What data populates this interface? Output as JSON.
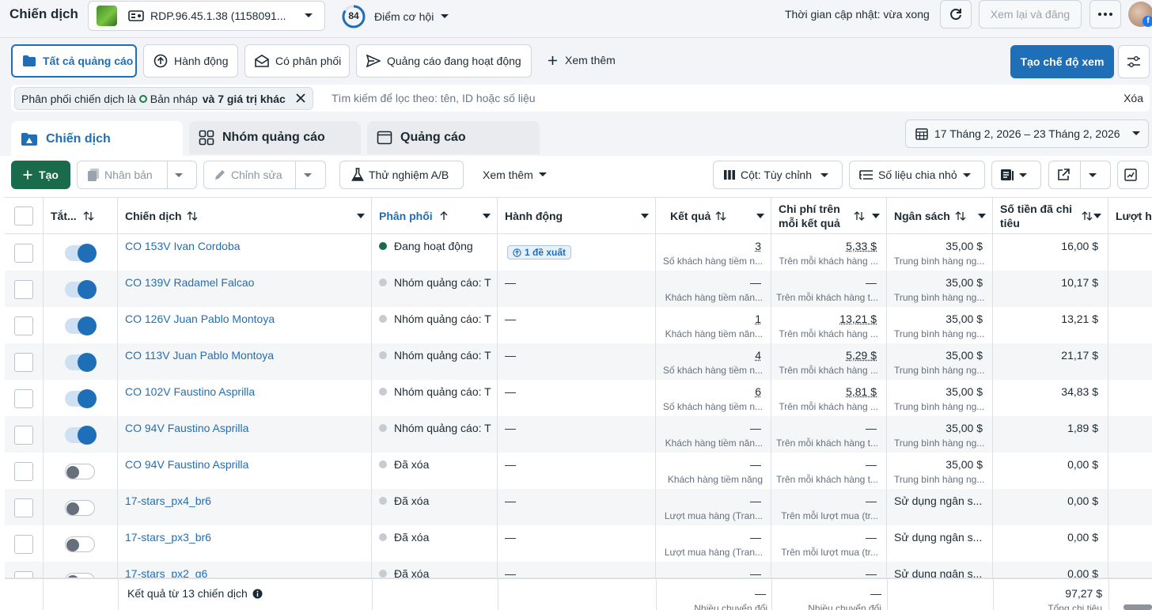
{
  "topbar": {
    "title": "Chiến dịch",
    "account_label": "RDP.96.45.1.38 (1158091...",
    "score": "84",
    "score_label": "Điểm cơ hội",
    "updated": "Thời gian cập nhật: vừa xong",
    "review_label": "Xem lại và đăng"
  },
  "views": {
    "all": "Tất cả quảng cáo",
    "action": "Hành động",
    "delivery": "Có phân phối",
    "active": "Quảng cáo đang hoạt động",
    "more": "Xem thêm",
    "create_view": "Tạo chế độ xem"
  },
  "filter": {
    "chip_prefix": "Phân phối chiến dịch là",
    "chip_value": "Bản nháp",
    "chip_more": "và 7 giá trị khác",
    "search_placeholder": "Tìm kiếm để lọc theo: tên, ID hoặc số liệu",
    "clear": "Xóa"
  },
  "level_tabs": {
    "campaign": "Chiến dịch",
    "adset": "Nhóm quảng cáo",
    "ad": "Quảng cáo"
  },
  "date_range": "17 Tháng 2, 2026 – 23 Tháng 2, 2026",
  "toolbar": {
    "create": "Tạo",
    "duplicate": "Nhân bản",
    "edit": "Chỉnh sửa",
    "ab_test": "Thử nghiệm A/B",
    "more": "Xem thêm",
    "columns": "Cột: Tùy chỉnh",
    "breakdown": "Số liệu chia nhỏ"
  },
  "columns": {
    "onoff": "Tắt...",
    "campaign": "Chiến dịch",
    "delivery": "Phân phối",
    "action": "Hành động",
    "results": "Kết quả",
    "cpr_line1": "Chi phí trên",
    "cpr_line2": "mỗi kết quả",
    "budget": "Ngân sách",
    "spent_line1": "Số tiền đã chi",
    "spent_line2": "tiêu",
    "reach": "Lượt h"
  },
  "rows": [
    {
      "on": true,
      "name": "CO 153V Ivan Cordoba",
      "status": "active",
      "delivery": "Đang hoạt động",
      "action": "1 đề xuất",
      "results": "3",
      "results_sub": "Số khách hàng tiềm n...",
      "cpr": "5,33 $",
      "cpr_sub": "Trên mỗi khách hàng ...",
      "budget": "35,00 $",
      "budget_sub": "Trung bình hàng ng...",
      "spent": "16,00 $"
    },
    {
      "on": true,
      "name": "CO 139V Radamel Falcao",
      "status": "inactive",
      "delivery": "Nhóm quảng cáo: T",
      "action": "—",
      "results": "—",
      "results_sub": "Khách hàng tiềm năn...",
      "cpr": "—",
      "cpr_sub": "Trên mỗi khách hàng t...",
      "budget": "35,00 $",
      "budget_sub": "Trung bình hàng ng...",
      "spent": "10,17 $"
    },
    {
      "on": true,
      "name": "CO 126V Juan Pablo Montoya",
      "status": "inactive",
      "delivery": "Nhóm quảng cáo: T",
      "action": "—",
      "results": "1",
      "results_sub": "Khách hàng tiềm năn...",
      "cpr": "13,21 $",
      "cpr_sub": "Trên mỗi khách hàng ...",
      "budget": "35,00 $",
      "budget_sub": "Trung bình hàng ng...",
      "spent": "13,21 $"
    },
    {
      "on": true,
      "name": "CO 113V Juan Pablo Montoya",
      "status": "inactive",
      "delivery": "Nhóm quảng cáo: T",
      "action": "—",
      "results": "4",
      "results_sub": "Số khách hàng tiềm n...",
      "cpr": "5,29 $",
      "cpr_sub": "Trên mỗi khách hàng ...",
      "budget": "35,00 $",
      "budget_sub": "Trung bình hàng ng...",
      "spent": "21,17 $"
    },
    {
      "on": true,
      "name": "CO 102V Faustino Asprilla",
      "status": "inactive",
      "delivery": "Nhóm quảng cáo: T",
      "action": "—",
      "results": "6",
      "results_sub": "Số khách hàng tiềm n...",
      "cpr": "5,81 $",
      "cpr_sub": "Trên mỗi khách hàng ...",
      "budget": "35,00 $",
      "budget_sub": "Trung bình hàng ng...",
      "spent": "34,83 $"
    },
    {
      "on": true,
      "name": "CO 94V Faustino Asprilla",
      "status": "inactive",
      "delivery": "Nhóm quảng cáo: T",
      "action": "—",
      "results": "—",
      "results_sub": "Khách hàng tiềm năn...",
      "cpr": "—",
      "cpr_sub": "Trên mỗi khách hàng t...",
      "budget": "35,00 $",
      "budget_sub": "Trung bình hàng ng...",
      "spent": "1,89 $"
    },
    {
      "on": false,
      "name": "CO 94V Faustino Asprilla",
      "status": "deleted",
      "delivery": "Đã xóa",
      "action": "—",
      "results": "—",
      "results_sub": "Khách hàng tiềm năng",
      "cpr": "—",
      "cpr_sub": "Trên mỗi khách hàng t...",
      "budget": "35,00 $",
      "budget_sub": "Trung bình hàng ng...",
      "spent": "0,00 $"
    },
    {
      "on": false,
      "name": "17-stars_px4_br6",
      "status": "deleted",
      "delivery": "Đã xóa",
      "action": "—",
      "results": "—",
      "results_sub": "Lượt mua hàng (Tran...",
      "cpr": "—",
      "cpr_sub": "Trên mỗi lượt mua (tr...",
      "budget": "Sử dụng ngân s...",
      "budget_sub": "",
      "spent": "0,00 $"
    },
    {
      "on": false,
      "name": "17-stars_px3_br6",
      "status": "deleted",
      "delivery": "Đã xóa",
      "action": "—",
      "results": "—",
      "results_sub": "Lượt mua hàng (Tran...",
      "cpr": "—",
      "cpr_sub": "Trên mỗi lượt mua (tr...",
      "budget": "Sử dụng ngân s...",
      "budget_sub": "",
      "spent": "0,00 $"
    },
    {
      "on": false,
      "name": "17-stars_px2_g6",
      "status": "deleted",
      "delivery": "Đã xóa",
      "action": "—",
      "results": "—",
      "results_sub": "",
      "cpr": "—",
      "cpr_sub": "",
      "budget": "Sử dụng ngân s...",
      "budget_sub": "",
      "spent": "0,00 $"
    }
  ],
  "footer": {
    "label": "Kết quả từ 13 chiến dịch",
    "results": "—",
    "results_sub": "Nhiều chuyển đổi",
    "cpr": "—",
    "cpr_sub": "Nhiều chuyển đổi",
    "spent": "97,27 $",
    "spent_sub": "Tổng chi tiêu"
  },
  "colors": {
    "primary": "#1e6fb8",
    "create_green": "#1a6b4b",
    "active_dot": "#1a6b4b",
    "inactive_dot": "#c7ccd2"
  }
}
